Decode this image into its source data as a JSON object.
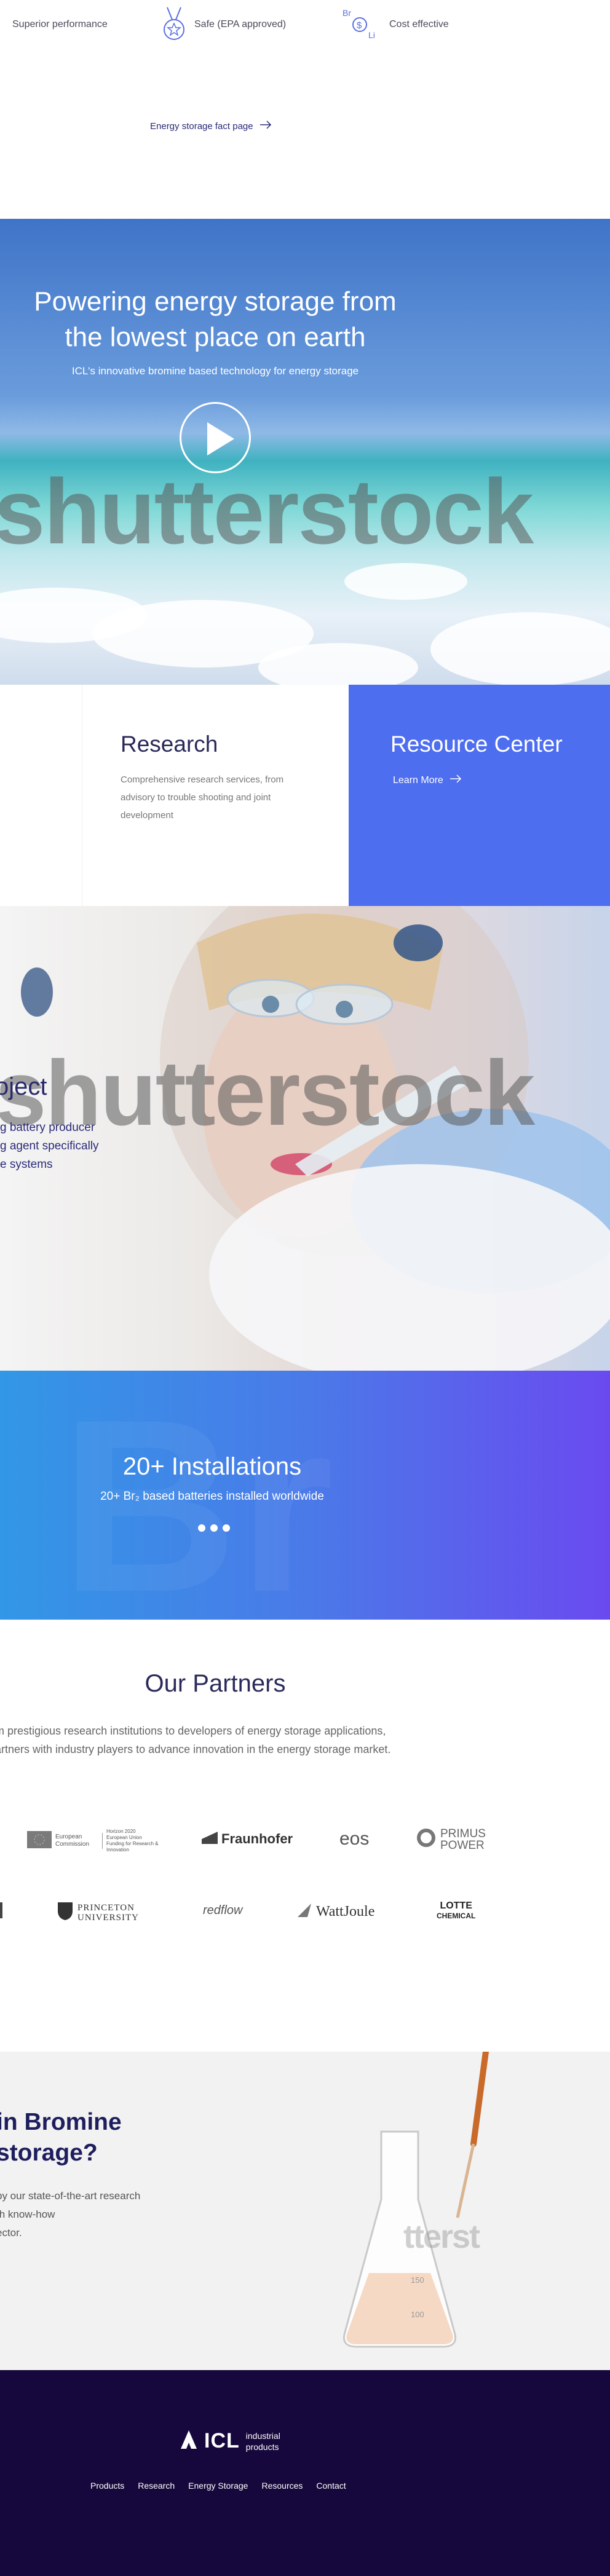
{
  "features": [
    {
      "label": "Superior performance",
      "icon": "performance-icon"
    },
    {
      "label": "Safe (EPA approved)",
      "icon": "medal-icon"
    },
    {
      "label": "Cost effective",
      "icon": "bromine-dollar-icon",
      "icon_text": [
        "Br",
        "$",
        "Li"
      ]
    }
  ],
  "factsheet": {
    "label": "Energy storage fact page"
  },
  "hero": {
    "title_line1": "Powering energy storage from",
    "title_line2": "the lowest place on earth",
    "subtitle": "ICL's innovative bromine based technology for energy storage",
    "watermark": "shutterstock"
  },
  "research": {
    "title": "Research",
    "description": "Comprehensive research services, from advisory to trouble shooting and joint development"
  },
  "resource_center": {
    "title": "Resource Center",
    "link": "Learn More"
  },
  "project": {
    "title": "oject",
    "lines": [
      "g battery producer",
      "g agent specifically",
      "e systems"
    ],
    "watermark": "shutterstock"
  },
  "installations": {
    "title": "20+ Installations",
    "subtitle": "20+ Br₂ based batteries installed worldwide",
    "background_letters": "Br"
  },
  "partners": {
    "title": "Our Partners",
    "line1": "m prestigious research institutions to developers of energy storage applications,",
    "line2": "artners with industry players to advance innovation in the energy storage market.",
    "row1": [
      "European Commission",
      "Horizon 2020",
      "Fraunhofer",
      "eos",
      "PRIMUS POWER"
    ],
    "row2": [
      "PRINCETON UNIVERSITY",
      "redflow",
      "WattJoule",
      "LOTTE CHEMICAL"
    ],
    "horizon_sub": "European Union Funding for Research & Innovation",
    "princeton_line1": "PRINCETON",
    "princeton_line2": "UNIVERSITY",
    "primus_line1": "PRIMUS",
    "primus_line2": "POWER",
    "lotte_line1": "LOTTE",
    "lotte_line2": "CHEMICAL"
  },
  "bromine": {
    "title_line1": "in Bromine",
    "title_line2": "storage?",
    "lines": [
      "by our state-of-the-art research",
      "th know-how",
      "ector."
    ],
    "watermark": "tterst",
    "flask_marks": [
      "150",
      "100"
    ]
  },
  "footer": {
    "brand": "ICL",
    "tag_line1": "industrial",
    "tag_line2": "products",
    "nav": [
      "Products",
      "Research",
      "Energy Storage",
      "Resources",
      "Contact"
    ]
  },
  "colors": {
    "accent": "#4e6ef0",
    "footer": "#16083c",
    "navy_text": "#2a2a5a"
  }
}
